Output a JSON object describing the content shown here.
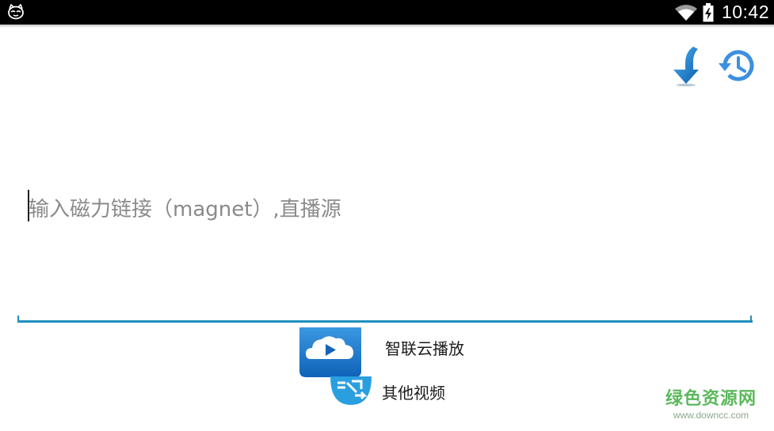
{
  "status_bar": {
    "left_icon": "cat-face-icon",
    "wifi_icon": "wifi-icon",
    "battery_icon": "battery-charging-icon",
    "time": "10:42"
  },
  "toolbar": {
    "download_icon": "download-arrow-icon",
    "history_icon": "history-clock-icon"
  },
  "link_input": {
    "placeholder": "输入磁力链接（magnet）,直播源",
    "value": ""
  },
  "options": [
    {
      "label": "智联云播放",
      "icon": "cloud-play-icon"
    },
    {
      "label": "其他视频",
      "icon": "share-arrows-icon"
    }
  ],
  "watermark": {
    "title": "绿色资源网",
    "url": "www.downcc.com"
  },
  "colors": {
    "accent": "#1f8fbf",
    "status_bar": "#000000",
    "download_icon": "#1e7fd0",
    "history_icon": "#3d8fe0",
    "watermark": "#5cb85c"
  }
}
